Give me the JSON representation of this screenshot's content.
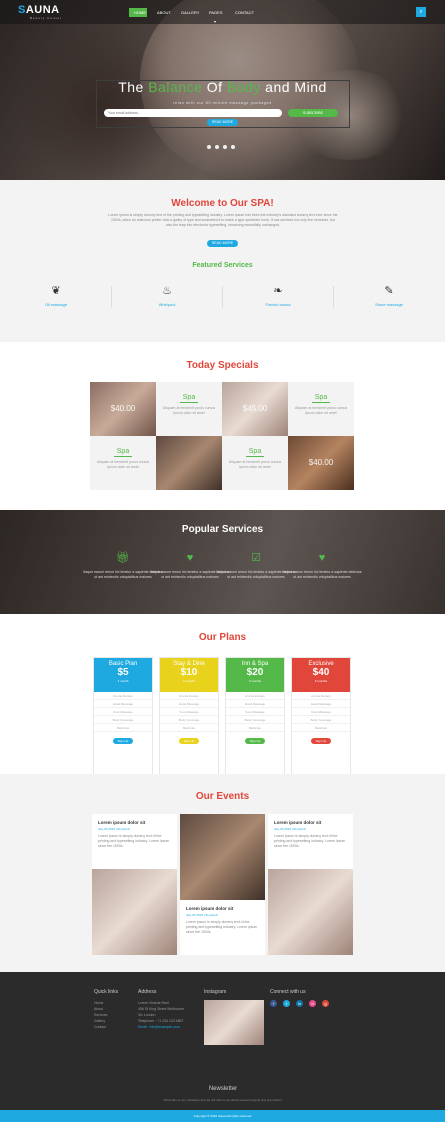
{
  "brand": {
    "logo": "AUNA",
    "logo_initial": "S",
    "tagline": "Beauty Center"
  },
  "nav": {
    "items": [
      {
        "label": "HOME"
      },
      {
        "label": "ABOUT"
      },
      {
        "label": "GALLERY"
      },
      {
        "label": "PAGES ▾"
      },
      {
        "label": "CONTACT"
      }
    ],
    "search_icon": "search-icon"
  },
  "hero": {
    "title_1": "The ",
    "title_2": "Balance",
    "title_3": " Of ",
    "title_4": "Body",
    "title_5": " and Mind",
    "subtitle": "relax with our 60 minute massage packages",
    "button": "READ MORE"
  },
  "welcome": {
    "title": "Welcome to Our SPA!",
    "text": "Lorem ipsum is simply dummy text of the printing and typesetting industry. Lorem Ipsum has been the industry's standard dummy text ever since the 1500s, when an unknown printer took a galley of type and scrambled it to make a type specimen book. It has survived not only five centuries, but also the leap into electronic typesetting, remaining essentially unchanged.",
    "button": "READ MORE"
  },
  "featured": {
    "title": "Featured Services",
    "items": [
      {
        "label": "Oil massage",
        "icon": "butterfly-icon"
      },
      {
        "label": "Whirlpool",
        "icon": "bath-icon"
      },
      {
        "label": "Finnish sauna",
        "icon": "leaf-icon"
      },
      {
        "label": "Stone massage",
        "icon": "brush-icon"
      }
    ]
  },
  "specials": {
    "title": "Today Specials",
    "prices": [
      "$40.00",
      "$45.00",
      "$40.00"
    ],
    "text_tiles": [
      {
        "title": "Spa",
        "text": "Aliquam at hendrerit purus cursus ipsum dolor sit amet"
      },
      {
        "title": "Spa",
        "text": "Aliquam at hendrerit purus cursus ipsum dolor sit amet"
      },
      {
        "title": "Spa",
        "text": "Aliquam at hendrerit purus cursus ipsum dolor sit amet"
      },
      {
        "title": "Spa",
        "text": "Aliquam at hendrerit purus cursus ipsum dolor sit amet"
      }
    ]
  },
  "popular": {
    "title": "Popular Services",
    "items": [
      {
        "icon": "gift-icon",
        "text": "Itaque earum rerum hic tenetur a sapiente delectus ut aut reiciendis voluptatibus maiores"
      },
      {
        "icon": "heart-icon",
        "text": "Itaque earum rerum hic tenetur a sapiente delectus ut aut reiciendis voluptatibus maiores"
      },
      {
        "icon": "check-icon",
        "text": "Itaque earum rerum hic tenetur a sapiente delectus ut aut reiciendis voluptatibus maiores"
      },
      {
        "icon": "heart-icon",
        "text": "Itaque earum rerum hic tenetur a sapiente delectus ut aut reiciendis voluptatibus maiores"
      }
    ]
  },
  "plans": {
    "title": "Our Plans",
    "items": [
      {
        "name": "Basic Plan",
        "price": "$5",
        "sub": "1 month",
        "color": "#1ea9e1",
        "rows": [
          "Aroma therapy",
          "Hand Massage",
          "Foot Massage",
          "Body Coverage",
          "Manicure"
        ],
        "button": "Sign Up"
      },
      {
        "name": "Stay & Dine",
        "price": "$10",
        "sub": "2 months",
        "color": "#e8d21c",
        "rows": [
          "Aroma therapy",
          "Hand Massage",
          "Foot Massage",
          "Body Coverage",
          "Manicure"
        ],
        "button": "Sign Up"
      },
      {
        "name": "Inn & Spa",
        "price": "$20",
        "sub": "3 months",
        "color": "#54b948",
        "rows": [
          "Aroma therapy",
          "Hand Massage",
          "Foot Massage",
          "Body Coverage",
          "Manicure"
        ],
        "button": "Sign Up"
      },
      {
        "name": "Exclusive",
        "price": "$40",
        "sub": "6 months",
        "color": "#e1463b",
        "rows": [
          "Aroma therapy",
          "Hand Massage",
          "Foot Massage",
          "Body Coverage",
          "Manicure"
        ],
        "button": "Sign Up"
      }
    ]
  },
  "events": {
    "title": "Our Events",
    "cards": [
      {
        "title": "Lorem ipsum dolor sit",
        "meta": "Sep 06 2015 | By Admin",
        "text": "Lorem ipsum is simply dummy text of the printing and typesetting industry. Lorem ipsum since the 1500s."
      },
      {
        "title": "Lorem ipsum dolor sit",
        "meta": "Sep 06 2015 | By Admin",
        "text": "Lorem ipsum is simply dummy text of the printing and typesetting industry. Lorem ipsum since the 1500s."
      },
      {
        "title": "Lorem ipsum dolor sit",
        "meta": "Sep 06 2015 | By Admin",
        "text": "Lorem ipsum is simply dummy text of the printing and typesetting industry. Lorem ipsum since the 1500s."
      }
    ]
  },
  "footer": {
    "quick_links_title": "Quick links",
    "quick_links": [
      "Home",
      "About",
      "Services",
      "Gallery",
      "Contact"
    ],
    "address_title": "Address",
    "address": [
      "Lorem Victoria Raid",
      "456 St King Street Melbourne",
      "Vic London",
      "Telephone : +1 234 123 4567",
      "Email : info@example.com"
    ],
    "instagram_title": "Instagram",
    "connect_title": "Connect with us",
    "social": [
      {
        "icon": "facebook-icon",
        "color": "#3b5998",
        "glyph": "f"
      },
      {
        "icon": "twitter-icon",
        "color": "#1ea9e1",
        "glyph": "t"
      },
      {
        "icon": "linkedin-icon",
        "color": "#0e76a8",
        "glyph": "in"
      },
      {
        "icon": "dribbble-icon",
        "color": "#ea4c89",
        "glyph": "d"
      },
      {
        "icon": "google-plus-icon",
        "color": "#dd4b39",
        "glyph": "g"
      }
    ],
    "newsletter_title": "Newsletter",
    "newsletter_text": "Subscribe to our newsletter and we will inform you about newest projects and promotions.",
    "newsletter_placeholder": "Your email address...",
    "newsletter_button": "SUBSCRIBE",
    "copyright": "Copyright © 2016 Sauna All rights reserved"
  }
}
